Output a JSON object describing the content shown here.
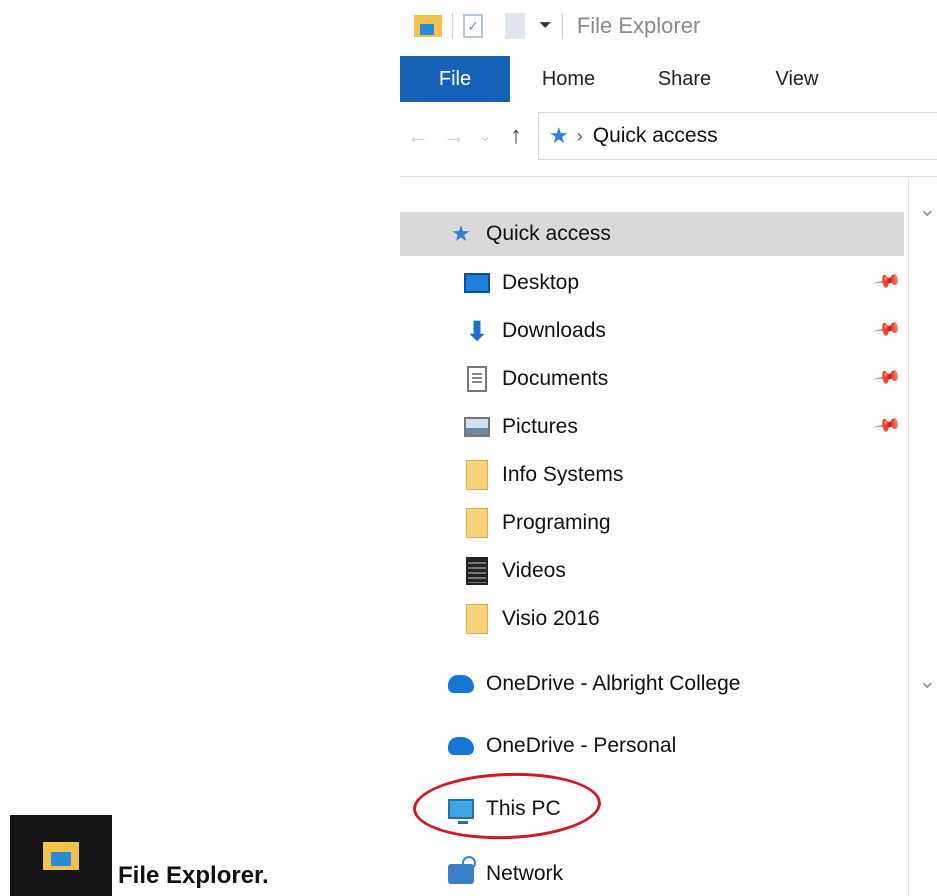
{
  "window": {
    "title": "File Explorer"
  },
  "ribbon": {
    "tabs": [
      "File",
      "Home",
      "Share",
      "View"
    ]
  },
  "address": {
    "location": "Quick access"
  },
  "nav": {
    "quick_access": "Quick access",
    "items": [
      {
        "label": "Desktop",
        "pinned": true,
        "icon": "desktop-icon"
      },
      {
        "label": "Downloads",
        "pinned": true,
        "icon": "downloads-icon"
      },
      {
        "label": "Documents",
        "pinned": true,
        "icon": "documents-icon"
      },
      {
        "label": "Pictures",
        "pinned": true,
        "icon": "pictures-icon"
      },
      {
        "label": "Info Systems",
        "pinned": false,
        "icon": "folder-icon"
      },
      {
        "label": "Programing",
        "pinned": false,
        "icon": "folder-icon"
      },
      {
        "label": "Videos",
        "pinned": false,
        "icon": "videos-icon"
      },
      {
        "label": "Visio 2016",
        "pinned": false,
        "icon": "folder-icon"
      }
    ],
    "onedrive_college": "OneDrive - Albright College",
    "onedrive_personal": "OneDrive - Personal",
    "this_pc": "This PC",
    "network": "Network"
  },
  "caption": {
    "text": "File Explorer."
  },
  "colors": {
    "file_tab": "#1562b6",
    "highlight_circle": "#d0182b",
    "selected_row": "#d9d9d9"
  }
}
